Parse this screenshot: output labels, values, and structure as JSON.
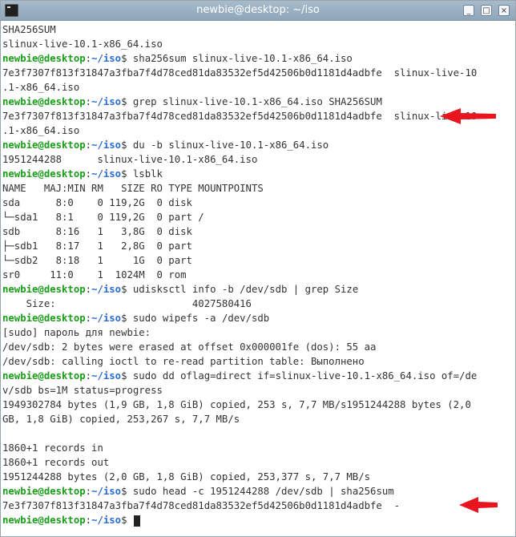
{
  "window": {
    "title": "newbie@desktop: ~/iso",
    "buttons": {
      "minimize": "_",
      "maximize": "□",
      "close": "×"
    }
  },
  "prompt": {
    "user": "newbie@desktop",
    "sep": ":",
    "path": "~/iso",
    "symbol": "$"
  },
  "terminal": {
    "lines": [
      {
        "type": "out",
        "text": "SHA256SUM"
      },
      {
        "type": "out",
        "text": "slinux-live-10.1-x86_64.iso"
      },
      {
        "type": "cmd",
        "text": " sha256sum slinux-live-10.1-x86_64.iso"
      },
      {
        "type": "out",
        "text": "7e3f7307f813f31847a3fba7f4d78ced81da83532ef5d42506b0d1181d4adbfe  slinux-live-10"
      },
      {
        "type": "out",
        "text": ".1-x86_64.iso"
      },
      {
        "type": "cmd",
        "text": " grep slinux-live-10.1-x86_64.iso SHA256SUM"
      },
      {
        "type": "out",
        "text": "7e3f7307f813f31847a3fba7f4d78ced81da83532ef5d42506b0d1181d4adbfe  slinux-live-10"
      },
      {
        "type": "out",
        "text": ".1-x86_64.iso"
      },
      {
        "type": "cmd",
        "text": " du -b slinux-live-10.1-x86_64.iso"
      },
      {
        "type": "out",
        "text": "1951244288      slinux-live-10.1-x86_64.iso"
      },
      {
        "type": "cmd",
        "text": " lsblk"
      },
      {
        "type": "out",
        "text": "NAME   MAJ:MIN RM   SIZE RO TYPE MOUNTPOINTS"
      },
      {
        "type": "out",
        "text": "sda      8:0    0 119,2G  0 disk"
      },
      {
        "type": "out",
        "text": "└─sda1   8:1    0 119,2G  0 part /"
      },
      {
        "type": "out",
        "text": "sdb      8:16   1   3,8G  0 disk"
      },
      {
        "type": "out",
        "text": "├─sdb1   8:17   1   2,8G  0 part"
      },
      {
        "type": "out",
        "text": "└─sdb2   8:18   1     1G  0 part"
      },
      {
        "type": "out",
        "text": "sr0     11:0    1  1024M  0 rom"
      },
      {
        "type": "cmd",
        "text": " udisksctl info -b /dev/sdb | grep Size"
      },
      {
        "type": "out",
        "text": "    Size:                       4027580416"
      },
      {
        "type": "cmd",
        "text": " sudo wipefs -a /dev/sdb"
      },
      {
        "type": "out",
        "text": "[sudo] пароль для newbie:"
      },
      {
        "type": "out",
        "text": "/dev/sdb: 2 bytes were erased at offset 0x000001fe (dos): 55 aa"
      },
      {
        "type": "out",
        "text": "/dev/sdb: calling ioctl to re-read partition table: Выполнено"
      },
      {
        "type": "cmd",
        "text": " sudo dd oflag=direct if=slinux-live-10.1-x86_64.iso of=/de"
      },
      {
        "type": "out",
        "text": "v/sdb bs=1M status=progress"
      },
      {
        "type": "out",
        "text": "1949302784 bytes (1,9 GB, 1,8 GiB) copied, 253 s, 7,7 MB/s1951244288 bytes (2,0"
      },
      {
        "type": "out",
        "text": "GB, 1,8 GiB) copied, 253,267 s, 7,7 MB/s"
      },
      {
        "type": "out",
        "text": ""
      },
      {
        "type": "out",
        "text": "1860+1 records in"
      },
      {
        "type": "out",
        "text": "1860+1 records out"
      },
      {
        "type": "out",
        "text": "1951244288 bytes (2,0 GB, 1,8 GiB) copied, 253,377 s, 7,7 MB/s"
      },
      {
        "type": "cmd",
        "text": " sudo head -c 1951244288 /dev/sdb | sha256sum"
      },
      {
        "type": "out",
        "text": "7e3f7307f813f31847a3fba7f4d78ced81da83532ef5d42506b0d1181d4adbfe  -"
      },
      {
        "type": "cmd",
        "text": " ",
        "cursor": true
      }
    ]
  },
  "annotations": [
    {
      "name": "red-arrow-icon",
      "color": "#e8141e"
    },
    {
      "name": "red-arrow-icon",
      "color": "#e8141e"
    }
  ]
}
